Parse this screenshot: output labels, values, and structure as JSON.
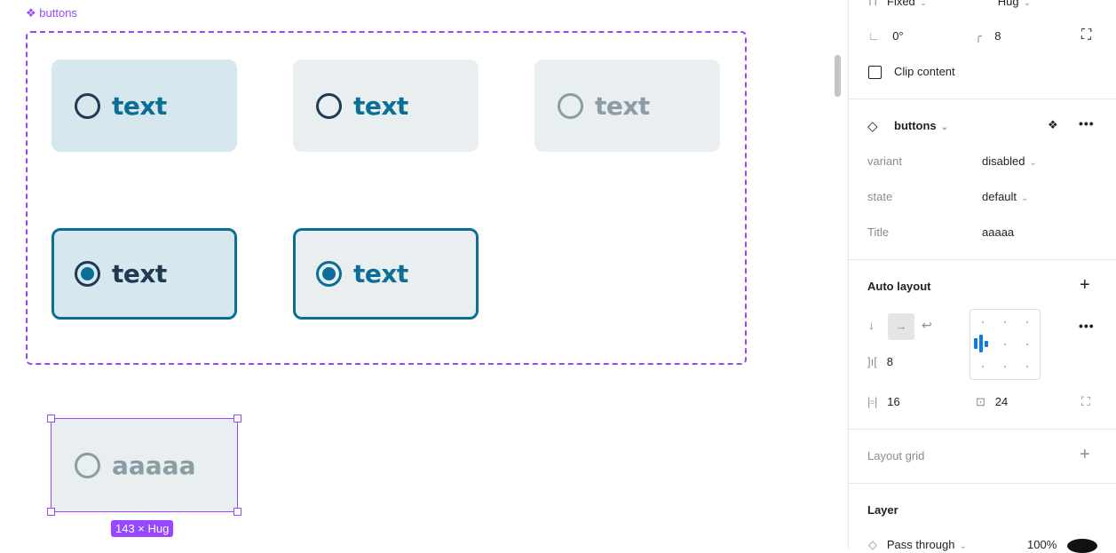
{
  "canvas": {
    "component_label": "buttons",
    "buttons": [
      {
        "label": "text",
        "state": "default-hover",
        "selected": false
      },
      {
        "label": "text",
        "state": "default",
        "selected": false
      },
      {
        "label": "text",
        "state": "disabled",
        "selected": false
      },
      {
        "label": "text",
        "state": "selected-hover",
        "selected": true
      },
      {
        "label": "text",
        "state": "selected",
        "selected": true
      }
    ],
    "instance": {
      "label": "aaaaa",
      "size_badge": "143 × Hug"
    }
  },
  "panel": {
    "width_mode": "Fixed",
    "height_mode": "Hug",
    "rotation": "0°",
    "corner_radius": "8",
    "clip_content": "Clip content",
    "component": {
      "name": "buttons",
      "props": [
        {
          "label": "variant",
          "value": "disabled"
        },
        {
          "label": "state",
          "value": "default"
        },
        {
          "label": "Title",
          "value": "aaaaa"
        }
      ]
    },
    "auto_layout": {
      "title": "Auto layout",
      "gap": "8",
      "h_padding": "16",
      "v_padding": "24"
    },
    "layout_grid": "Layout grid",
    "layer": {
      "title": "Layer",
      "blend": "Pass through",
      "opacity": "100%"
    }
  },
  "colors": {
    "accent": "#9747ff",
    "primary": "#0b6e96",
    "dark": "#1f3a52",
    "disabled": "#8c9ca4"
  }
}
